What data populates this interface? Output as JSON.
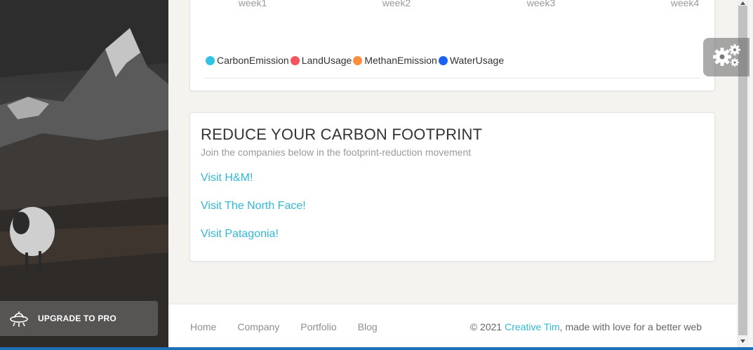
{
  "chart": {
    "ticks": [
      "week1",
      "week2",
      "week3",
      "week4"
    ],
    "legend": [
      {
        "name": "CarbonEmission",
        "color": "#31c2e6"
      },
      {
        "name": "LandUsage",
        "color": "#f3545d"
      },
      {
        "name": "MethanEmission",
        "color": "#fd8f3c"
      },
      {
        "name": "WaterUsage",
        "color": "#1d62f0"
      }
    ]
  },
  "promo": {
    "title": "REDUCE YOUR CARBON FOOTPRINT",
    "subtitle": "Join the companies below in the footprint-reduction movement",
    "links": [
      "Visit H&M!",
      "Visit The North Face!",
      "Visit Patagonia!"
    ]
  },
  "sidebar": {
    "upgrade_label": "UPGRADE TO PRO",
    "upgrade_icon": "ufo-icon"
  },
  "footer": {
    "nav": [
      "Home",
      "Company",
      "Portfolio",
      "Blog"
    ],
    "copyright_prefix": "© 2021 ",
    "copyright_link": "Creative Tim",
    "copyright_suffix": ", made with love for a better web"
  },
  "settings": {
    "icon": "gears-icon"
  },
  "colors": {
    "accent": "#31b8d6"
  }
}
